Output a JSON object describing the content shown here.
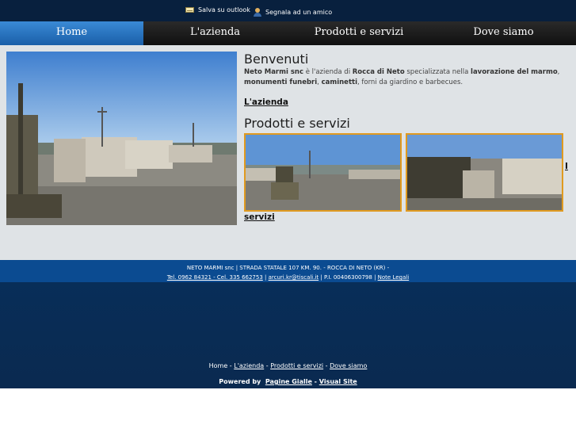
{
  "topbar": {
    "save_outlook": "Salva su outlook",
    "tell_friend": "Segnala ad un amico",
    "save_icon": "mail-icon",
    "friend_icon": "user-icon"
  },
  "nav": {
    "items": [
      {
        "label": "Home",
        "active": true
      },
      {
        "label": "L'azienda",
        "active": false
      },
      {
        "label": "Prodotti e servizi",
        "active": false
      },
      {
        "label": "Dove siamo",
        "active": false
      }
    ],
    "active_color": "#2a7acc"
  },
  "main": {
    "welcome_title": "Benvenuti",
    "intro": {
      "company": "Neto Marmi snc",
      "t1": " è l'azienda di ",
      "place": "Rocca di Neto",
      "t2": " specializzata nella ",
      "k1": "lavorazione del marmo",
      "t3": ", ",
      "k2": "monumenti funebri",
      "t4": ", ",
      "k3": "caminetti",
      "t5": ", forni da giardino e barbecues."
    },
    "azienda_link": "L'azienda",
    "products_title": "Prodotti e servizi",
    "services_link_a": "I",
    "services_link_b": "servizi",
    "thumb_border": "#e09a20"
  },
  "footer": {
    "address": "NETO MARMI snc | STRADA STATALE 107 KM. 90. - ROCCA DI NETO (KR) -",
    "phones": "Tel. 0962 84321 - Cel. 335 662753",
    "sep1": " | ",
    "email": "arcuri.kr@tiscali.it",
    "vat": " | P.I. 00406300798 | ",
    "legal": "Note Legali"
  },
  "bottom_nav": {
    "home": "Home",
    "sep": " - ",
    "azienda": "L'azienda",
    "prodotti": "Prodotti e servizi",
    "dove": "Dove siamo"
  },
  "powered": {
    "label": "Powered by",
    "pg": "Pagine Gialle",
    "sep": " - ",
    "vs": "Visual Site"
  }
}
